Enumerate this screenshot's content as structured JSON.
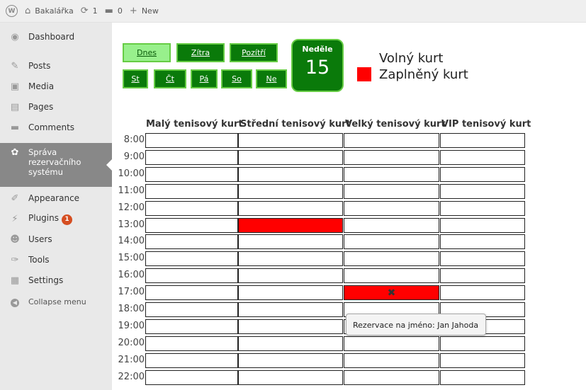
{
  "adminbar": {
    "site_name": "Bakalářka",
    "updates_count": "1",
    "comments_count": "0",
    "new_label": "New"
  },
  "sidebar": {
    "items": [
      {
        "label": "Dashboard",
        "icon": "dashboard-icon"
      },
      {
        "label": "Posts",
        "icon": "pin-icon"
      },
      {
        "label": "Media",
        "icon": "media-icon"
      },
      {
        "label": "Pages",
        "icon": "pages-icon"
      },
      {
        "label": "Comments",
        "icon": "comment-icon"
      },
      {
        "label": "Správa rezervačního systému",
        "icon": "gear-icon",
        "active": true
      },
      {
        "label": "Appearance",
        "icon": "brush-icon"
      },
      {
        "label": "Plugins",
        "icon": "plugin-icon",
        "badge": "1"
      },
      {
        "label": "Users",
        "icon": "users-icon"
      },
      {
        "label": "Tools",
        "icon": "wrench-icon"
      },
      {
        "label": "Settings",
        "icon": "settings-icon"
      },
      {
        "label": "Collapse menu",
        "icon": "collapse-icon"
      }
    ]
  },
  "day_buttons": {
    "row1": [
      "Dnes",
      "Zítra",
      "Pozítří"
    ],
    "row2": [
      "St",
      "Čt",
      "Pá",
      "So",
      "Ne"
    ],
    "selected": "Dnes"
  },
  "current_day": {
    "name": "Neděle",
    "number": "15"
  },
  "legend": {
    "free": {
      "label": "Volný kurt",
      "color": "#ffffff"
    },
    "taken": {
      "label": "Zaplněný kurt",
      "color": "#ff0000"
    }
  },
  "schedule": {
    "courts": [
      "Malý tenisový kurt",
      "Střední tenisový kurt",
      "Velký tenisový kurt",
      "VIP tenisový kurt"
    ],
    "times": [
      "8:00",
      "9:00",
      "10:00",
      "11:00",
      "12:00",
      "13:00",
      "14:00",
      "15:00",
      "16:00",
      "17:00",
      "18:00",
      "19:00",
      "20:00",
      "21:00",
      "22:00"
    ],
    "reservations": [
      {
        "time": "13:00",
        "court": "Střední tenisový kurt"
      },
      {
        "time": "17:00",
        "court": "Velký tenisový kurt",
        "marked": true
      }
    ]
  },
  "tooltip": "Rezervace na jméno: Jan Jahoda",
  "colors": {
    "accent_green": "#0a7a0a",
    "selected_green": "#98f08c",
    "taken_red": "#ff0000"
  }
}
